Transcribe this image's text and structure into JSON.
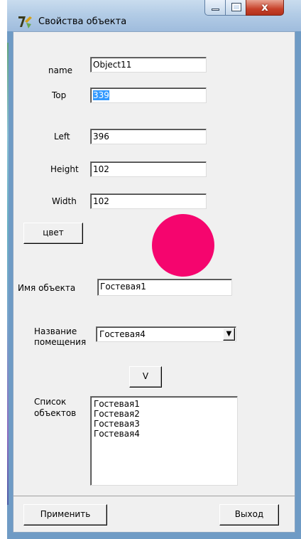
{
  "window": {
    "title": "Свойства объекта",
    "controls": {
      "minimize": "–",
      "maximize": "□",
      "close": "x"
    }
  },
  "form": {
    "name_label": "name",
    "name_value": "Object11",
    "top_label": "Top",
    "top_value": "339",
    "left_label": "Left",
    "left_value": "396",
    "height_label": "Height",
    "height_value": "102",
    "width_label": "Width",
    "width_value": "102",
    "color_button": "цвет",
    "object_name_label": "Имя объекта",
    "object_name_value": "Гостевая1",
    "room_label_line1": "Название",
    "room_label_line2": "помещения",
    "room_value": "Гостевая4",
    "add_button": "V",
    "list_label_line1": "Список",
    "list_label_line2": "объектов",
    "list_items": [
      "Гостевая1",
      "Гостевая2",
      "Гостевая3",
      "Гостевая4"
    ],
    "apply_button": "Применить",
    "exit_button": "Выход"
  },
  "colors": {
    "object_color": "#f5056e",
    "selection": "#3399ff",
    "dialog_bg": "#f0f0f0"
  },
  "icons": {
    "app": "app-logo-icon",
    "dropdown": "chevron-down-icon"
  }
}
